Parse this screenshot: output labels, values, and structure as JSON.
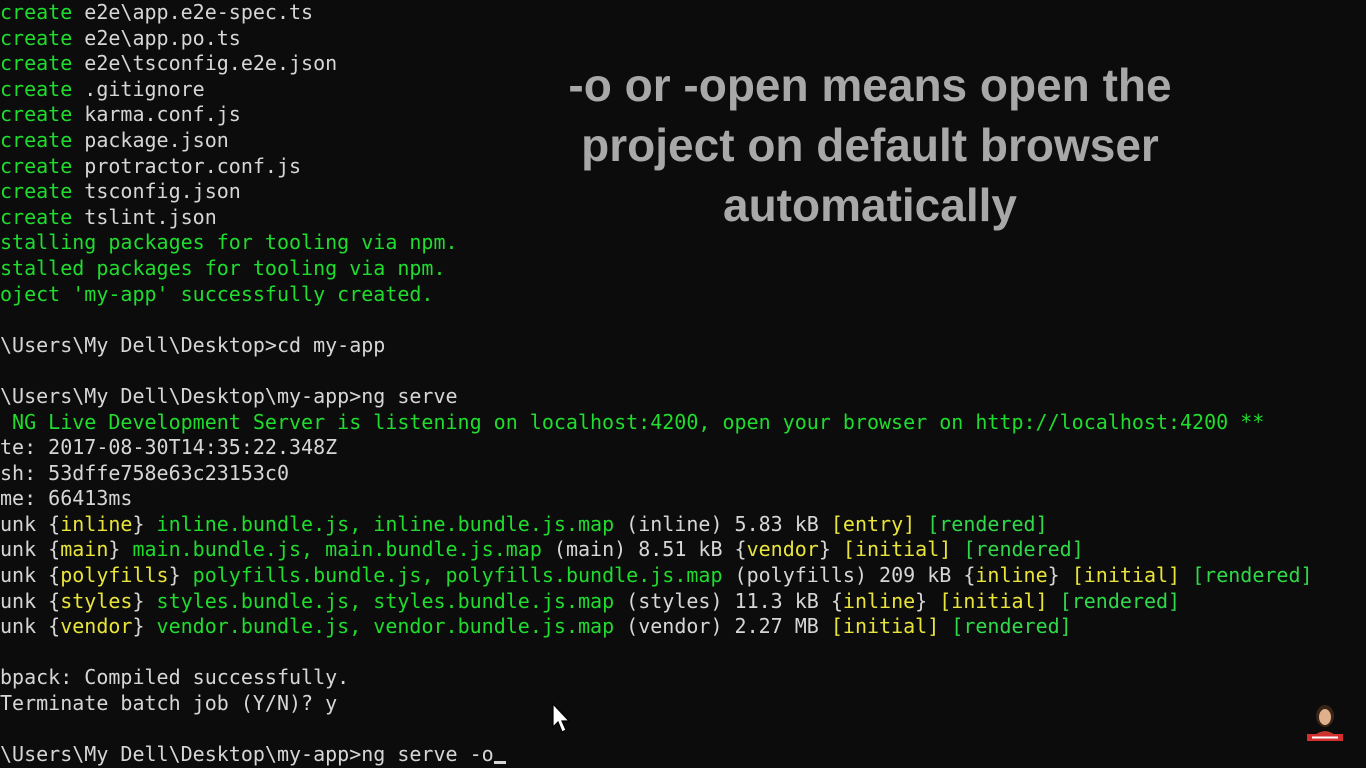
{
  "terminal": {
    "lines": [
      {
        "segments": [
          {
            "t": "create ",
            "c": "g"
          },
          {
            "t": "e2e\\app.e2e-spec.ts",
            "c": "w"
          }
        ]
      },
      {
        "segments": [
          {
            "t": "create ",
            "c": "g"
          },
          {
            "t": "e2e\\app.po.ts",
            "c": "w"
          }
        ]
      },
      {
        "segments": [
          {
            "t": "create ",
            "c": "g"
          },
          {
            "t": "e2e\\tsconfig.e2e.json",
            "c": "w"
          }
        ]
      },
      {
        "segments": [
          {
            "t": "create ",
            "c": "g"
          },
          {
            "t": ".gitignore",
            "c": "w"
          }
        ]
      },
      {
        "segments": [
          {
            "t": "create ",
            "c": "g"
          },
          {
            "t": "karma.conf.js",
            "c": "w"
          }
        ]
      },
      {
        "segments": [
          {
            "t": "create ",
            "c": "g"
          },
          {
            "t": "package.json",
            "c": "w"
          }
        ]
      },
      {
        "segments": [
          {
            "t": "create ",
            "c": "g"
          },
          {
            "t": "protractor.conf.js",
            "c": "w"
          }
        ]
      },
      {
        "segments": [
          {
            "t": "create ",
            "c": "g"
          },
          {
            "t": "tsconfig.json",
            "c": "w"
          }
        ]
      },
      {
        "segments": [
          {
            "t": "create ",
            "c": "g"
          },
          {
            "t": "tslint.json",
            "c": "w"
          }
        ]
      },
      {
        "segments": [
          {
            "t": "stalling packages for tooling via npm.",
            "c": "g"
          }
        ]
      },
      {
        "segments": [
          {
            "t": "stalled packages for tooling via npm.",
            "c": "g"
          }
        ]
      },
      {
        "segments": [
          {
            "t": "oject 'my-app' successfully created.",
            "c": "g"
          }
        ]
      },
      {
        "segments": [
          {
            "t": "",
            "c": "w"
          }
        ]
      },
      {
        "segments": [
          {
            "t": "\\Users\\My Dell\\Desktop>cd my-app",
            "c": "w"
          }
        ]
      },
      {
        "segments": [
          {
            "t": "",
            "c": "w"
          }
        ]
      },
      {
        "segments": [
          {
            "t": "\\Users\\My Dell\\Desktop\\my-app>ng serve",
            "c": "w"
          }
        ]
      },
      {
        "segments": [
          {
            "t": " NG Live Development Server is listening on localhost:4200, open your browser on http://localhost:4200 **",
            "c": "g"
          }
        ]
      },
      {
        "segments": [
          {
            "t": "te: 2017-08-30T14:35:22.348Z",
            "c": "w"
          }
        ]
      },
      {
        "segments": [
          {
            "t": "sh: 53dffe758e63c23153c0",
            "c": "w"
          }
        ]
      },
      {
        "segments": [
          {
            "t": "me: 66413ms",
            "c": "w"
          }
        ]
      },
      {
        "segments": [
          {
            "t": "unk ",
            "c": "w"
          },
          {
            "t": "{",
            "c": "w"
          },
          {
            "t": "inline",
            "c": "y"
          },
          {
            "t": "}",
            "c": "w"
          },
          {
            "t": " inline.bundle.js, inline.bundle.js.map",
            "c": "g"
          },
          {
            "t": " (inline) 5.83 kB ",
            "c": "w"
          },
          {
            "t": "[entry]",
            "c": "y"
          },
          {
            "t": " [rendered]",
            "c": "lg"
          }
        ]
      },
      {
        "segments": [
          {
            "t": "unk ",
            "c": "w"
          },
          {
            "t": "{",
            "c": "w"
          },
          {
            "t": "main",
            "c": "y"
          },
          {
            "t": "}",
            "c": "w"
          },
          {
            "t": " main.bundle.js, main.bundle.js.map",
            "c": "g"
          },
          {
            "t": " (main) 8.51 kB ",
            "c": "w"
          },
          {
            "t": "{",
            "c": "w"
          },
          {
            "t": "vendor",
            "c": "y"
          },
          {
            "t": "} ",
            "c": "w"
          },
          {
            "t": "[initial]",
            "c": "y"
          },
          {
            "t": " [rendered]",
            "c": "lg"
          }
        ]
      },
      {
        "segments": [
          {
            "t": "unk ",
            "c": "w"
          },
          {
            "t": "{",
            "c": "w"
          },
          {
            "t": "polyfills",
            "c": "y"
          },
          {
            "t": "}",
            "c": "w"
          },
          {
            "t": " polyfills.bundle.js, polyfills.bundle.js.map",
            "c": "g"
          },
          {
            "t": " (polyfills) 209 kB ",
            "c": "w"
          },
          {
            "t": "{",
            "c": "w"
          },
          {
            "t": "inline",
            "c": "y"
          },
          {
            "t": "} ",
            "c": "w"
          },
          {
            "t": "[initial]",
            "c": "y"
          },
          {
            "t": " [rendered]",
            "c": "lg"
          }
        ]
      },
      {
        "segments": [
          {
            "t": "unk ",
            "c": "w"
          },
          {
            "t": "{",
            "c": "w"
          },
          {
            "t": "styles",
            "c": "y"
          },
          {
            "t": "}",
            "c": "w"
          },
          {
            "t": " styles.bundle.js, styles.bundle.js.map",
            "c": "g"
          },
          {
            "t": " (styles) 11.3 kB ",
            "c": "w"
          },
          {
            "t": "{",
            "c": "w"
          },
          {
            "t": "inline",
            "c": "y"
          },
          {
            "t": "} ",
            "c": "w"
          },
          {
            "t": "[initial]",
            "c": "y"
          },
          {
            "t": " [rendered]",
            "c": "lg"
          }
        ]
      },
      {
        "segments": [
          {
            "t": "unk ",
            "c": "w"
          },
          {
            "t": "{",
            "c": "w"
          },
          {
            "t": "vendor",
            "c": "y"
          },
          {
            "t": "}",
            "c": "w"
          },
          {
            "t": " vendor.bundle.js, vendor.bundle.js.map",
            "c": "g"
          },
          {
            "t": " (vendor) 2.27 MB ",
            "c": "w"
          },
          {
            "t": "[initial]",
            "c": "y"
          },
          {
            "t": " [rendered]",
            "c": "lg"
          }
        ]
      },
      {
        "segments": [
          {
            "t": "",
            "c": "w"
          }
        ]
      },
      {
        "segments": [
          {
            "t": "bpack: Compiled successfully.",
            "c": "w"
          }
        ]
      },
      {
        "segments": [
          {
            "t": "Terminate batch job (Y/N)? y",
            "c": "w"
          }
        ]
      },
      {
        "segments": [
          {
            "t": "",
            "c": "w"
          }
        ]
      },
      {
        "segments": [
          {
            "t": "\\Users\\My Dell\\Desktop\\my-app>ng serve -o",
            "c": "w"
          }
        ],
        "cursor": true
      }
    ]
  },
  "overlay": {
    "lines": [
      "-o or -open means open the",
      "project on default browser",
      "automatically"
    ]
  },
  "icons": {
    "mouse": "mouse-pointer-icon",
    "logo": "channel-logo-icon"
  },
  "colors": {
    "background": "#0c0c0c",
    "text": "#d6d6d6",
    "green": "#1fdc2e",
    "yellow": "#e9e43a",
    "overlay": "#a8a8a8"
  }
}
